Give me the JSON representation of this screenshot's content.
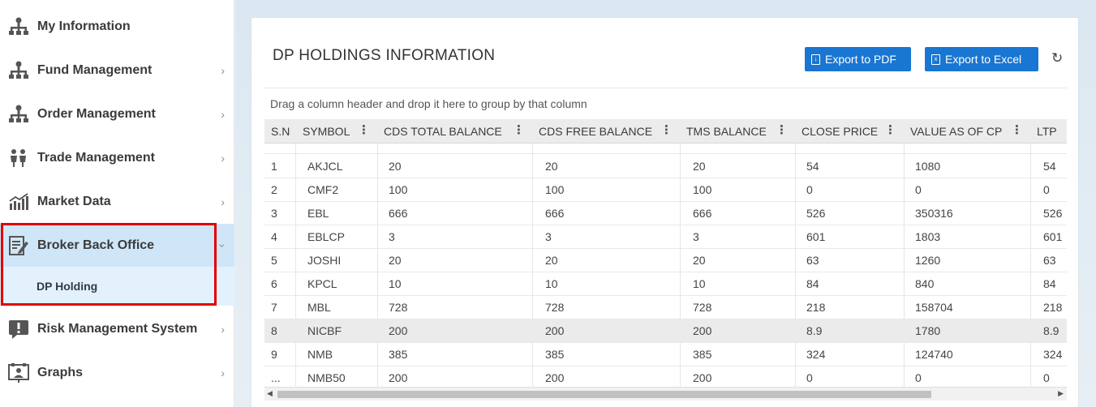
{
  "sidebar": {
    "items": [
      {
        "label": "My Information",
        "icon": "org-chart-icon",
        "has_chevron": false
      },
      {
        "label": "Fund Management",
        "icon": "org-chart-icon",
        "has_chevron": true
      },
      {
        "label": "Order Management",
        "icon": "org-chart-icon",
        "has_chevron": true
      },
      {
        "label": "Trade Management",
        "icon": "people-icon",
        "has_chevron": true
      },
      {
        "label": "Market Data",
        "icon": "bar-chart-icon",
        "has_chevron": true
      },
      {
        "label": "Broker Back Office",
        "icon": "document-edit-icon",
        "has_chevron": true,
        "expanded": true
      },
      {
        "label": "Risk Management System",
        "icon": "alert-message-icon",
        "has_chevron": true
      },
      {
        "label": "Graphs",
        "icon": "presentation-icon",
        "has_chevron": true
      }
    ],
    "sub_items": [
      {
        "label": "DP Holding",
        "active": true
      }
    ],
    "active_color": "#cfe6f8",
    "highlight_color": "#e00000"
  },
  "main": {
    "title": "DP HOLDINGS INFORMATION",
    "buttons": {
      "export_pdf": "Export to PDF",
      "export_excel": "Export to Excel"
    },
    "accent_color": "#1976d2",
    "group_panel_text": "Drag a column header and drop it here to group by that column",
    "grid": {
      "columns": [
        "S.N",
        "SYMBOL",
        "CDS TOTAL BALANCE",
        "CDS FREE BALANCE",
        "TMS BALANCE",
        "CLOSE PRICE",
        "VALUE AS OF CP",
        "LTP"
      ],
      "rows": [
        [
          "1",
          "AKJCL",
          "20",
          "20",
          "20",
          "54",
          "1080",
          "54"
        ],
        [
          "2",
          "CMF2",
          "100",
          "100",
          "100",
          "0",
          "0",
          "0"
        ],
        [
          "3",
          "EBL",
          "666",
          "666",
          "666",
          "526",
          "350316",
          "526"
        ],
        [
          "4",
          "EBLCP",
          "3",
          "3",
          "3",
          "601",
          "1803",
          "601"
        ],
        [
          "5",
          "JOSHI",
          "20",
          "20",
          "20",
          "63",
          "1260",
          "63"
        ],
        [
          "6",
          "KPCL",
          "10",
          "10",
          "10",
          "84",
          "840",
          "84"
        ],
        [
          "7",
          "MBL",
          "728",
          "728",
          "728",
          "218",
          "158704",
          "218"
        ],
        [
          "8",
          "NICBF",
          "200",
          "200",
          "200",
          "8.9",
          "1780",
          "8.9"
        ],
        [
          "9",
          "NMB",
          "385",
          "385",
          "385",
          "324",
          "124740",
          "324"
        ],
        [
          "...",
          "NMB50",
          "200",
          "200",
          "200",
          "0",
          "0",
          "0"
        ]
      ],
      "hovered_row": 7
    }
  }
}
